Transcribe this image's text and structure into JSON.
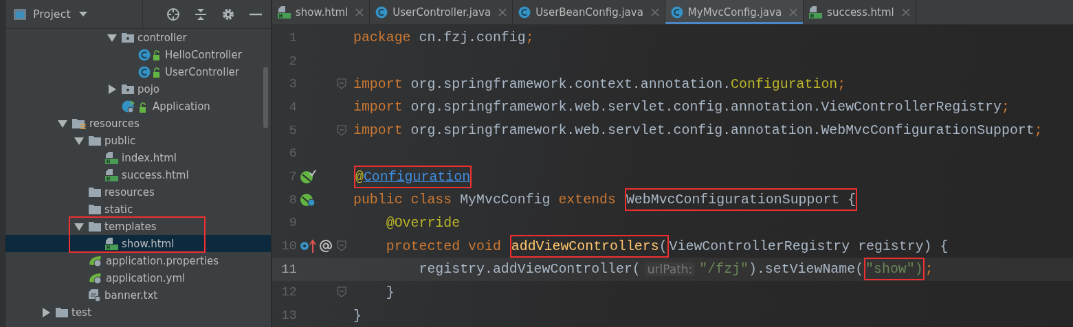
{
  "sidebar": {
    "title": "Project",
    "tree": [
      {
        "children": [
          {
            "children": [
              {
                "children": [
                  {
                    "children": [
                      {
                        "label": "controller",
                        "kind": "package",
                        "expanded": true,
                        "selected": false,
                        "children": [
                          {
                            "label": "HelloController",
                            "kind": "class",
                            "selected": false
                          },
                          {
                            "label": "UserController",
                            "kind": "class",
                            "selected": false
                          }
                        ]
                      },
                      {
                        "label": "pojo",
                        "kind": "package",
                        "expanded": false,
                        "selected": false
                      },
                      {
                        "label": "Application",
                        "kind": "app-class",
                        "selected": false
                      }
                    ]
                  }
                ]
              }
            ]
          },
          {
            "label": "resources",
            "kind": "resource-root",
            "expanded": true,
            "selected": false,
            "children": [
              {
                "label": "public",
                "kind": "folder",
                "expanded": true,
                "selected": false,
                "children": [
                  {
                    "label": "index.html",
                    "kind": "html",
                    "selected": false
                  },
                  {
                    "label": "success.html",
                    "kind": "html",
                    "selected": false
                  }
                ]
              },
              {
                "label": "resources",
                "kind": "folder",
                "selected": false
              },
              {
                "label": "static",
                "kind": "folder",
                "selected": false
              },
              {
                "label": "templates",
                "kind": "folder",
                "expanded": true,
                "selected": false,
                "boxed": true,
                "children": [
                  {
                    "label": "show.html",
                    "kind": "html",
                    "selected": true
                  }
                ]
              },
              {
                "label": "application.properties",
                "kind": "spring",
                "selected": false
              },
              {
                "label": "application.yml",
                "kind": "spring",
                "selected": false
              },
              {
                "label": "banner.txt",
                "kind": "text",
                "selected": false
              }
            ]
          }
        ]
      },
      {
        "label": "test",
        "kind": "folder",
        "expanded": false,
        "selected": false
      }
    ]
  },
  "editor": {
    "tabs": [
      {
        "label": "show.html",
        "kind": "html",
        "selected": false
      },
      {
        "label": "UserController.java",
        "kind": "java",
        "selected": false
      },
      {
        "label": "UserBeanConfig.java",
        "kind": "java",
        "selected": false
      },
      {
        "label": "MyMvcConfig.java",
        "kind": "java",
        "selected": true
      },
      {
        "label": "success.html",
        "kind": "html",
        "selected": false
      }
    ],
    "lines": [
      {
        "num": "1",
        "current": false,
        "tokens": [
          {
            "text": "package",
            "kind": "keyword"
          },
          {
            "text": " cn.fzj.config",
            "kind": "plain"
          },
          {
            "text": ";",
            "kind": "semi"
          }
        ]
      },
      {
        "num": "2",
        "current": false
      },
      {
        "num": "3",
        "current": false,
        "gutter": [
          {
            "kind": "fold"
          }
        ],
        "tokens": [
          {
            "text": "import",
            "kind": "keyword"
          },
          {
            "text": " org.springframework.context.annotation.",
            "kind": "plain"
          },
          {
            "text": "Configuration",
            "kind": "classref"
          },
          {
            "text": ";",
            "kind": "semi"
          }
        ]
      },
      {
        "num": "4",
        "current": false,
        "tokens": [
          {
            "text": "import",
            "kind": "keyword"
          },
          {
            "text": " org.springframework.web.servlet.config.annotation.ViewControllerRegistry",
            "kind": "plain"
          },
          {
            "text": ";",
            "kind": "semi"
          }
        ]
      },
      {
        "num": "5",
        "current": false,
        "gutter": [
          {
            "kind": "fold"
          }
        ],
        "tokens": [
          {
            "text": "import",
            "kind": "keyword"
          },
          {
            "text": " org.springframework.web.servlet.config.annotation.WebMvcConfigurationSupport",
            "kind": "plain"
          },
          {
            "text": ";",
            "kind": "semi"
          }
        ]
      },
      {
        "num": "6",
        "current": false
      },
      {
        "num": "7",
        "current": false,
        "gutter": [
          {
            "kind": "bean"
          }
        ],
        "tokens": [
          {
            "boxed": true,
            "tokens": [
              {
                "text": "@",
                "kind": "annotation"
              },
              {
                "text": "Configuration",
                "kind": "link"
              }
            ]
          }
        ]
      },
      {
        "num": "8",
        "current": false,
        "gutter": [
          {
            "kind": "bean-class"
          }
        ],
        "tokens": [
          {
            "text": "public class",
            "kind": "keyword"
          },
          {
            "text": " MyMvcConfig ",
            "kind": "plain"
          },
          {
            "text": "extends ",
            "kind": "keyword"
          },
          {
            "boxed": true,
            "tokens": [
              {
                "text": "WebMvcConfigurationSupport {",
                "kind": "plain"
              }
            ]
          }
        ]
      },
      {
        "num": "9",
        "current": false,
        "tokens": [
          {
            "text": "    @Override",
            "kind": "annotation"
          }
        ]
      },
      {
        "num": "10",
        "current": false,
        "gutter": [
          {
            "kind": "override"
          },
          {
            "kind": "at"
          },
          {
            "kind": "fold"
          }
        ],
        "tokens": [
          {
            "text": "    protected void ",
            "kind": "keyword"
          },
          {
            "boxed": true,
            "tokens": [
              {
                "text": "addViewControllers",
                "kind": "method"
              },
              {
                "text": "(",
                "kind": "plain"
              }
            ]
          },
          {
            "text": "ViewControllerRegistry registry) {",
            "kind": "plain"
          }
        ]
      },
      {
        "num": "11",
        "current": true,
        "tokens": [
          {
            "text": "        registry.addViewController(",
            "kind": "plain"
          },
          {
            "text": "urlPath:",
            "kind": "hint"
          },
          {
            "text": "\"/fzj\"",
            "kind": "string"
          },
          {
            "text": ").setViewName(",
            "kind": "plain"
          },
          {
            "boxed": true,
            "tokens": [
              {
                "text": "\"show\")",
                "kind": "string"
              }
            ]
          },
          {
            "text": ";",
            "kind": "semi"
          }
        ]
      },
      {
        "num": "12",
        "current": false,
        "gutter": [
          {
            "kind": "fold"
          }
        ],
        "tokens": [
          {
            "text": "    }",
            "kind": "plain"
          }
        ]
      },
      {
        "num": "13",
        "current": false,
        "tokens": [
          {
            "text": "}",
            "kind": "plain"
          }
        ]
      }
    ]
  }
}
